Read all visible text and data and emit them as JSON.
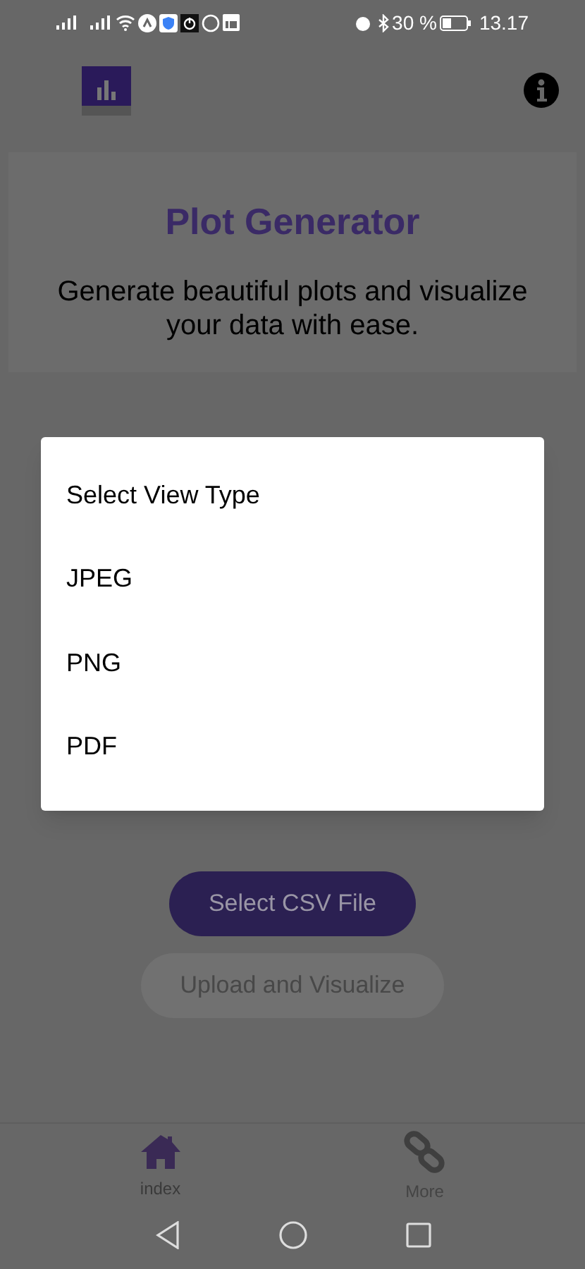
{
  "status_bar": {
    "battery": "30 %",
    "time": "13.17"
  },
  "card": {
    "title": "Plot Generator",
    "subtitle": "Generate beautiful plots and visualize your data with ease."
  },
  "buttons": [
    {
      "label": "Select CSV File",
      "disabled": false
    },
    {
      "label": "Upload and Visualize",
      "disabled": true
    }
  ],
  "dialog": {
    "title": "Select View Type",
    "options": [
      "JPEG",
      "PNG",
      "PDF"
    ]
  },
  "tabs": [
    {
      "label": "index",
      "kind": "home",
      "selected": true
    },
    {
      "label": "More",
      "kind": "link",
      "selected": false
    }
  ]
}
